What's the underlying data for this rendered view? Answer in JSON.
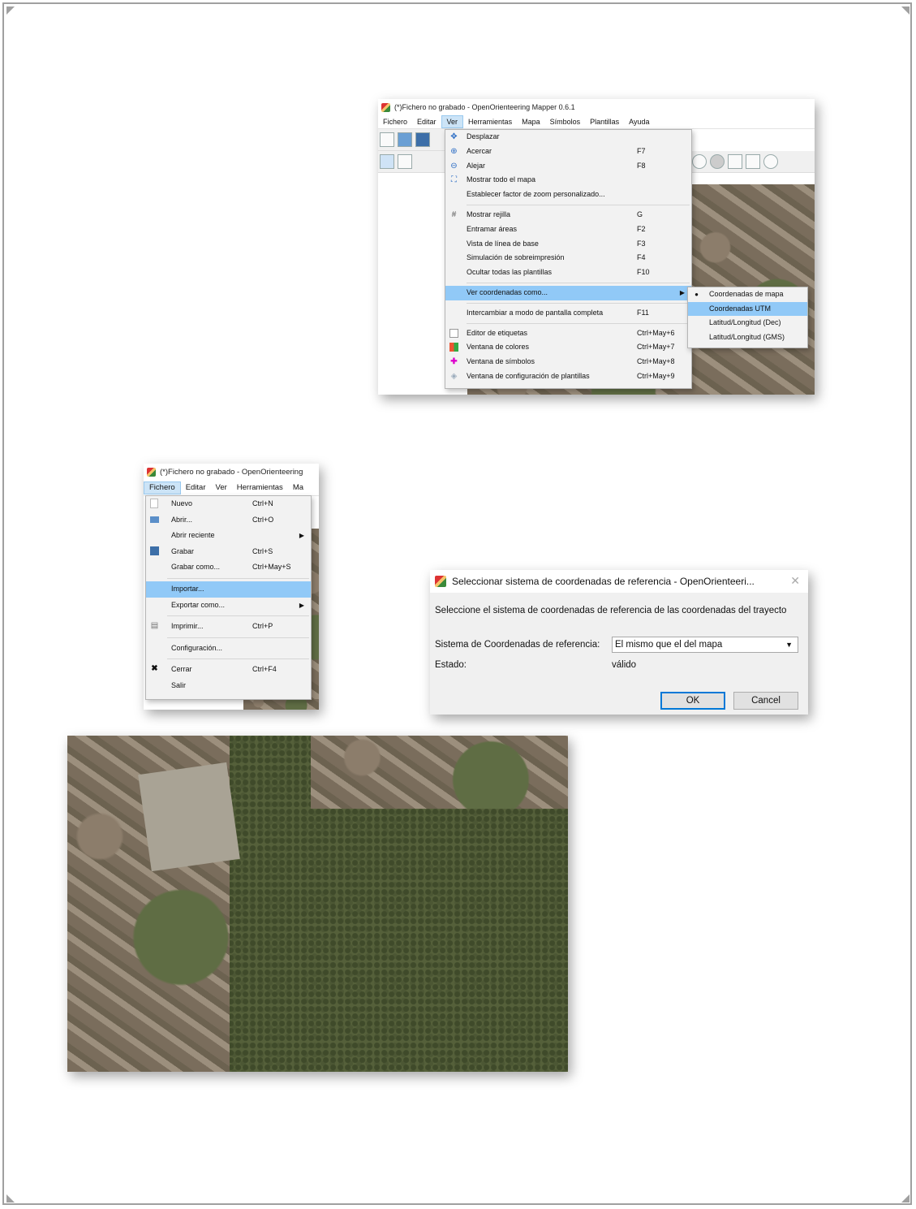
{
  "window1": {
    "title": "(*)Fichero no grabado - OpenOrienteering Mapper 0.6.1",
    "menubar": [
      "Fichero",
      "Editar",
      "Ver",
      "Herramientas",
      "Mapa",
      "Símbolos",
      "Plantillas",
      "Ayuda"
    ],
    "ver_menu": [
      {
        "label": "Desplazar",
        "shortcut": "",
        "icon": "move-icon"
      },
      {
        "label": "Acercar",
        "shortcut": "F7",
        "icon": "zoom-in-icon"
      },
      {
        "label": "Alejar",
        "shortcut": "F8",
        "icon": "zoom-out-icon"
      },
      {
        "label": "Mostrar todo el mapa",
        "shortcut": "",
        "icon": "fit-map-icon"
      },
      {
        "label": "Establecer factor de zoom personalizado...",
        "shortcut": "",
        "icon": ""
      },
      {
        "label": "Mostrar rejilla",
        "shortcut": "G",
        "icon": "grid-icon"
      },
      {
        "label": "Entramar áreas",
        "shortcut": "F2",
        "icon": ""
      },
      {
        "label": "Vista de línea de base",
        "shortcut": "F3",
        "icon": ""
      },
      {
        "label": "Simulación de sobreimpresión",
        "shortcut": "F4",
        "icon": ""
      },
      {
        "label": "Ocultar todas las plantillas",
        "shortcut": "F10",
        "icon": ""
      },
      {
        "label": "Ver coordenadas como...",
        "shortcut": "",
        "icon": ""
      },
      {
        "label": "Intercambiar a modo de pantalla completa",
        "shortcut": "F11",
        "icon": ""
      },
      {
        "label": "Editor de etiquetas",
        "shortcut": "Ctrl+May+6",
        "icon": "tag-editor-icon"
      },
      {
        "label": "Ventana de colores",
        "shortcut": "Ctrl+May+7",
        "icon": "colors-icon"
      },
      {
        "label": "Ventana de símbolos",
        "shortcut": "Ctrl+May+8",
        "icon": "symbols-icon"
      },
      {
        "label": "Ventana de configuración de plantillas",
        "shortcut": "Ctrl+May+9",
        "icon": "templates-icon"
      }
    ],
    "coord_submenu": [
      "Coordenadas de mapa",
      "Coordenadas UTM",
      "Latitud/Longitud (Dec)",
      "Latitud/Longitud (GMS)"
    ]
  },
  "window2": {
    "title": "(*)Fichero no grabado - OpenOrienteering",
    "menubar": [
      "Fichero",
      "Editar",
      "Ver",
      "Herramientas",
      "Ma"
    ],
    "fichero_menu": [
      {
        "label": "Nuevo",
        "shortcut": "Ctrl+N"
      },
      {
        "label": "Abrir...",
        "shortcut": "Ctrl+O"
      },
      {
        "label": "Abrir reciente",
        "shortcut": ""
      },
      {
        "label": "Grabar",
        "shortcut": "Ctrl+S"
      },
      {
        "label": "Grabar como...",
        "shortcut": "Ctrl+May+S"
      },
      {
        "label": "Importar...",
        "shortcut": ""
      },
      {
        "label": "Exportar como...",
        "shortcut": ""
      },
      {
        "label": "Imprimir...",
        "shortcut": "Ctrl+P"
      },
      {
        "label": "Configuración...",
        "shortcut": ""
      },
      {
        "label": "Cerrar",
        "shortcut": "Ctrl+F4"
      },
      {
        "label": "Salir",
        "shortcut": ""
      }
    ]
  },
  "dialog": {
    "title": "Seleccionar sistema de coordenadas de referencia - OpenOrienteeri...",
    "prompt": "Seleccione el sistema de coordenadas de referencia de las coordenadas del trayecto",
    "crs_label": "Sistema de Coordenadas de referencia:",
    "crs_value": "El mismo que el del mapa",
    "status_label": "Estado:",
    "status_value": "válido",
    "ok": "OK",
    "cancel": "Cancel"
  }
}
